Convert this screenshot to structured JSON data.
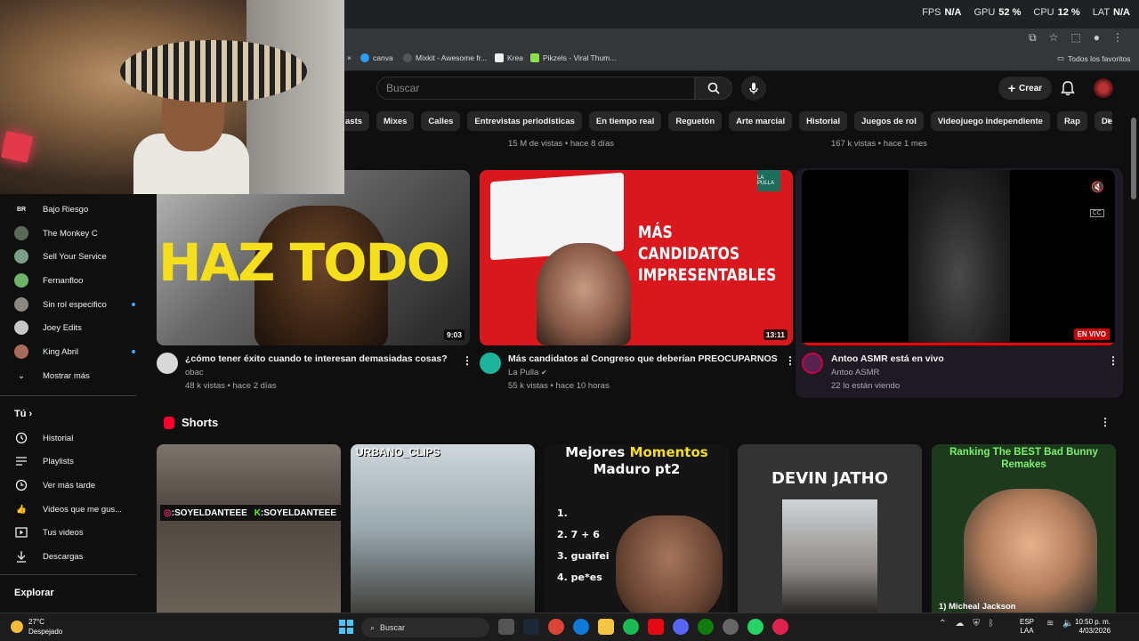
{
  "overlay": {
    "fps_label": "FPS",
    "fps_value": "N/A",
    "gpu_label": "GPU",
    "gpu_value": "52 %",
    "cpu_label": "CPU",
    "cpu_value": "12 %",
    "lat_label": "LAT",
    "lat_value": "N/A"
  },
  "bookmarks": {
    "items": [
      {
        "label": "canva",
        "icon": "canva-icon",
        "color": "#2a9df4"
      },
      {
        "label": "Mixkit - Awesome fr...",
        "icon": "mixkit-icon",
        "color": "#444444"
      },
      {
        "label": "Krea",
        "icon": "krea-icon",
        "color": "#111111"
      },
      {
        "label": "Pikzels - Viral Thum...",
        "icon": "pikzels-icon",
        "color": "#8ae04a"
      }
    ],
    "all_favorites": "Todos los favoritos"
  },
  "header": {
    "search_placeholder": "Buscar",
    "create_label": "Crear"
  },
  "chips": [
    "asts",
    "Mixes",
    "Calles",
    "Entrevistas periodísticas",
    "En tiempo real",
    "Reguetón",
    "Arte marcial",
    "Historial",
    "Juegos de rol",
    "Videojuego independiente",
    "Rap",
    "Destinos turí"
  ],
  "top_meta": {
    "left": "15 M de vistas • hace 8 días",
    "right": "167 k vistas • hace 1 mes"
  },
  "sidebar": {
    "subscriptions": [
      {
        "label": "Bajo Riesgo",
        "avatar_text": "BR",
        "live": false
      },
      {
        "label": "The Monkey C",
        "live": false
      },
      {
        "label": "Sell Your Service",
        "live": false
      },
      {
        "label": "Fernanfloo",
        "live": false
      },
      {
        "label": "Sin rol especifico",
        "live": true
      },
      {
        "label": "Joey Edits",
        "live": false
      },
      {
        "label": "King Abril",
        "live": true
      }
    ],
    "show_more": "Mostrar más",
    "you_header": "Tú",
    "you_items": [
      {
        "label": "Historial",
        "icon": "history-icon"
      },
      {
        "label": "Playlists",
        "icon": "playlists-icon"
      },
      {
        "label": "Ver más tarde",
        "icon": "watch-later-icon"
      },
      {
        "label": "Videos que me gus...",
        "icon": "liked-icon"
      },
      {
        "label": "Tus videos",
        "icon": "your-videos-icon"
      },
      {
        "label": "Descargas",
        "icon": "downloads-icon"
      }
    ],
    "explore_header": "Explorar"
  },
  "videos": [
    {
      "thumb_text": "HAZ TODO",
      "duration": "9:03",
      "title": "¿cómo tener éxito cuando te interesan demasiadas cosas?",
      "channel": "obac",
      "stats": "48 k vistas • hace 2 días"
    },
    {
      "thumb_text": "MÁS CANDIDATOS IMPRESENTABLES",
      "badge": "LA PULLA",
      "duration": "13:11",
      "title": "Más candidatos al Congreso que deberían PREOCUPARNOS",
      "channel": "La Pulla",
      "stats": "55 k vistas • hace 10 horas"
    },
    {
      "live_badge": "EN VIVO",
      "cc": "CC",
      "title": "Antoo ASMR está en vivo",
      "channel": "Antoo ASMR",
      "stats": "22 lo están viendo"
    }
  ],
  "shorts": {
    "header": "Shorts",
    "items": [
      {
        "tag_a": ":SOYELDANTEEE",
        "tag_b": ":SOYELDANTEEE"
      },
      {
        "label": "URBANO_CLIPS"
      },
      {
        "title_a": "Mejores ",
        "title_b": "Momentos",
        "title_c": "Maduro pt2",
        "list": [
          "1.",
          "2. 7 + 6",
          "3. guaifei",
          "4. pe*es"
        ]
      },
      {
        "title": "DEVIN JATHO"
      },
      {
        "title": "Ranking The BEST Bad Bunny Remakes",
        "caption": "1) Micheal Jackson"
      }
    ]
  },
  "taskbar": {
    "temp": "27°C",
    "weather": "Despejado",
    "search": "Buscar",
    "lang_a": "ESP",
    "lang_b": "LAA",
    "time": "10:50 p. m.",
    "date": "4/03/2026"
  }
}
